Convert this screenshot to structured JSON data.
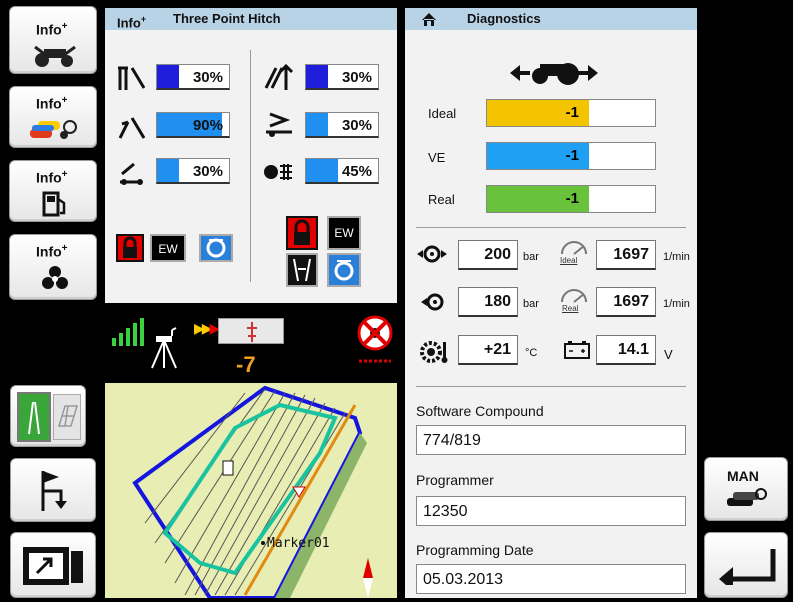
{
  "side_buttons": {
    "hitch": "Info",
    "implement": "Info",
    "fuel": "Info",
    "transmission": "Info",
    "sup": "+"
  },
  "hitch_panel": {
    "title_prefix": "Info",
    "title_sup": "+",
    "title": "Three Point Hitch",
    "left_bars": [
      {
        "value": "30%",
        "fraction": 0.3
      },
      {
        "value": "90%",
        "fraction": 0.9
      },
      {
        "value": "30%",
        "fraction": 0.3
      }
    ],
    "right_bars": [
      {
        "value": "30%",
        "fraction": 0.3
      },
      {
        "value": "30%",
        "fraction": 0.3
      },
      {
        "value": "45%",
        "fraction": 0.45
      }
    ],
    "ew_left": "EW",
    "ew_right": "EW"
  },
  "status_strip": {
    "offset_value": "-7"
  },
  "map": {
    "marker_label": "Marker01"
  },
  "diagnostics": {
    "title": "Diagnostics",
    "rows": [
      {
        "label": "Ideal",
        "value": "-1",
        "color": "#f5c400"
      },
      {
        "label": "VE",
        "value": "-1",
        "color": "#1fa0f2"
      },
      {
        "label": "Real",
        "value": "-1",
        "color": "#68c23c"
      }
    ],
    "pressure_1": {
      "value": "200",
      "unit": "bar"
    },
    "rpm_ideal": {
      "value": "1697",
      "unit": "1/min",
      "tag": "Ideal"
    },
    "pressure_2": {
      "value": "180",
      "unit": "bar"
    },
    "rpm_real": {
      "value": "1697",
      "unit": "1/min",
      "tag": "Real"
    },
    "temperature": {
      "value": "+21",
      "unit": "°C"
    },
    "voltage": {
      "value": "14.1",
      "unit": "V"
    },
    "software_compound_label": "Software Compound",
    "software_compound_value": "774/819",
    "programmer_label": "Programmer",
    "programmer_value": "12350",
    "programming_date_label": "Programming Date",
    "programming_date_value": "05.03.2013"
  },
  "right_buttons": {
    "man_label": "MAN"
  },
  "colors": {
    "panel_bg": "#f2f2f2",
    "header_bg": "#b9d3e6",
    "bar_dark": "#1e1edb",
    "bar_light": "#1f8ff0",
    "map_bg": "#e8eeb3"
  }
}
